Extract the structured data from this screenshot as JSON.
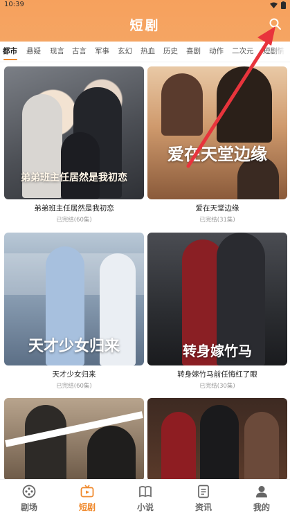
{
  "status": {
    "time": "10:39"
  },
  "header": {
    "title": "短剧"
  },
  "tabs": [
    {
      "label": "都市",
      "active": true
    },
    {
      "label": "悬疑"
    },
    {
      "label": "现言"
    },
    {
      "label": "古言"
    },
    {
      "label": "军事"
    },
    {
      "label": "玄幻"
    },
    {
      "label": "热血"
    },
    {
      "label": "历史"
    },
    {
      "label": "喜剧"
    },
    {
      "label": "动作"
    },
    {
      "label": "二次元"
    },
    {
      "label": "短剧情"
    }
  ],
  "cards": [
    {
      "title": "弟弟班主任居然是我初恋",
      "status": "已完结(60集)",
      "art": "弟弟班主任居然是我初恋"
    },
    {
      "title": "爱在天堂边缘",
      "status": "已完结(31集)",
      "art": "爱在天堂边缘"
    },
    {
      "title": "天才少女归来",
      "status": "已完结(60集)",
      "art": "天才少女归来"
    },
    {
      "title": "转身嫁竹马前任悔红了眼",
      "status": "已完结(30集)",
      "art": "转身嫁竹马"
    },
    {
      "title": "",
      "status": "",
      "art": ""
    },
    {
      "title": "",
      "status": "",
      "art": ""
    }
  ],
  "nav": [
    {
      "label": "剧场",
      "icon": "film-reel-icon"
    },
    {
      "label": "短剧",
      "icon": "tv-icon",
      "active": true
    },
    {
      "label": "小说",
      "icon": "book-icon"
    },
    {
      "label": "资讯",
      "icon": "document-icon"
    },
    {
      "label": "我的",
      "icon": "user-icon"
    }
  ],
  "colors": {
    "brand": "#f5a15c",
    "accent": "#f08a2e",
    "arrow": "#e8343c"
  }
}
